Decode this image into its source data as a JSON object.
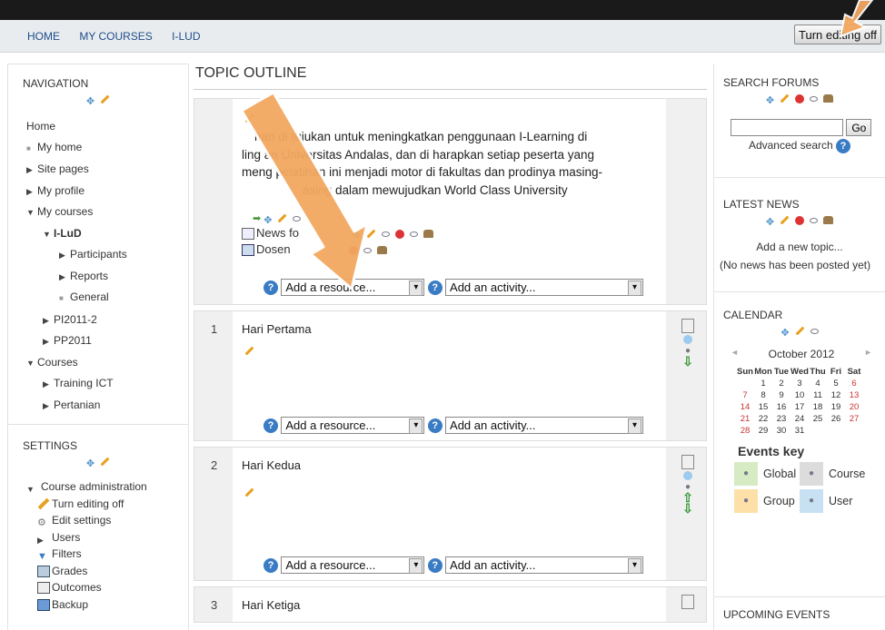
{
  "nav": {
    "links": [
      "HOME",
      "MY COURSES",
      "I-LUD"
    ],
    "edit_button": "Turn editing off"
  },
  "navigation": {
    "title": "NAVIGATION",
    "items": [
      {
        "label": "Home",
        "level": 0,
        "marker": ""
      },
      {
        "label": "My home",
        "level": 1,
        "marker": "bullet"
      },
      {
        "label": "Site pages",
        "level": 1,
        "marker": "right"
      },
      {
        "label": "My profile",
        "level": 1,
        "marker": "right"
      },
      {
        "label": "My courses",
        "level": 1,
        "marker": "down"
      },
      {
        "label": "I-LuD",
        "level": 2,
        "marker": "down"
      },
      {
        "label": "Participants",
        "level": 3,
        "marker": "right"
      },
      {
        "label": "Reports",
        "level": 3,
        "marker": "right"
      },
      {
        "label": "General",
        "level": 3,
        "marker": "bullet"
      },
      {
        "label": "PI2011-2",
        "level": 2,
        "marker": "right"
      },
      {
        "label": "PP2011",
        "level": 2,
        "marker": "right"
      },
      {
        "label": "Courses",
        "level": 1,
        "marker": "down"
      },
      {
        "label": "Training ICT",
        "level": 2,
        "marker": "right"
      },
      {
        "label": "Pertanian",
        "level": 2,
        "marker": "right"
      }
    ]
  },
  "settings": {
    "title": "SETTINGS",
    "items": [
      {
        "label": "Course administration",
        "icon": "down"
      },
      {
        "label": "Turn editing off",
        "icon": "pencil"
      },
      {
        "label": "Edit settings",
        "icon": "gear"
      },
      {
        "label": "Users",
        "icon": "right"
      },
      {
        "label": "Filters",
        "icon": "filter"
      },
      {
        "label": "Grades",
        "icon": "grades"
      },
      {
        "label": "Outcomes",
        "icon": "outcomes"
      },
      {
        "label": "Backup",
        "icon": "backup"
      }
    ]
  },
  "main": {
    "title": "TOPIC OUTLINE",
    "summary_lines": [
      "han di tujukan untuk meningkatkan penggunaan I-Learning di",
      "ling        an Universitas Andalas, dan di harapkan setiap peserta yang",
      "meng        pelatihan ini menjadi motor di fakultas dan prodinya masing-",
      "asing dalam mewujudkan World Class University"
    ],
    "resources": [
      "News fo",
      "Dosen"
    ],
    "add_resource": "Add a resource...",
    "add_activity": "Add an activity...",
    "help": "?",
    "sections": [
      {
        "num": "1",
        "name": "Hari Pertama"
      },
      {
        "num": "2",
        "name": "Hari Kedua"
      },
      {
        "num": "3",
        "name": "Hari Ketiga"
      }
    ]
  },
  "search": {
    "title": "SEARCH FORUMS",
    "go": "Go",
    "advanced": "Advanced search"
  },
  "news": {
    "title": "LATEST NEWS",
    "add": "Add a new topic...",
    "none": "(No news has been posted yet)"
  },
  "calendar": {
    "title": "CALENDAR",
    "month": "October 2012",
    "prev": "◄",
    "next": "►",
    "days": [
      "Sun",
      "Mon",
      "Tue",
      "Wed",
      "Thu",
      "Fri",
      "Sat"
    ],
    "weeks": [
      [
        "",
        "1",
        "2",
        "3",
        "4",
        "5",
        "6"
      ],
      [
        "7",
        "8",
        "9",
        "10",
        "11",
        "12",
        "13"
      ],
      [
        "14",
        "15",
        "16",
        "17",
        "18",
        "19",
        "20"
      ],
      [
        "21",
        "22",
        "23",
        "24",
        "25",
        "26",
        "27"
      ],
      [
        "28",
        "29",
        "30",
        "31",
        "",
        "",
        ""
      ]
    ],
    "events_key": "Events key",
    "keys": [
      {
        "label": "Global",
        "color": "#d6ebc4"
      },
      {
        "label": "Course",
        "color": "#dcdcdc"
      },
      {
        "label": "Group",
        "color": "#fde0a8"
      },
      {
        "label": "User",
        "color": "#c7e1f3"
      }
    ]
  },
  "upcoming": {
    "title": "UPCOMING EVENTS"
  },
  "colors": {
    "link": "#1e4c8a",
    "arrow": "#f0a050",
    "help": "#3a7cc4"
  }
}
